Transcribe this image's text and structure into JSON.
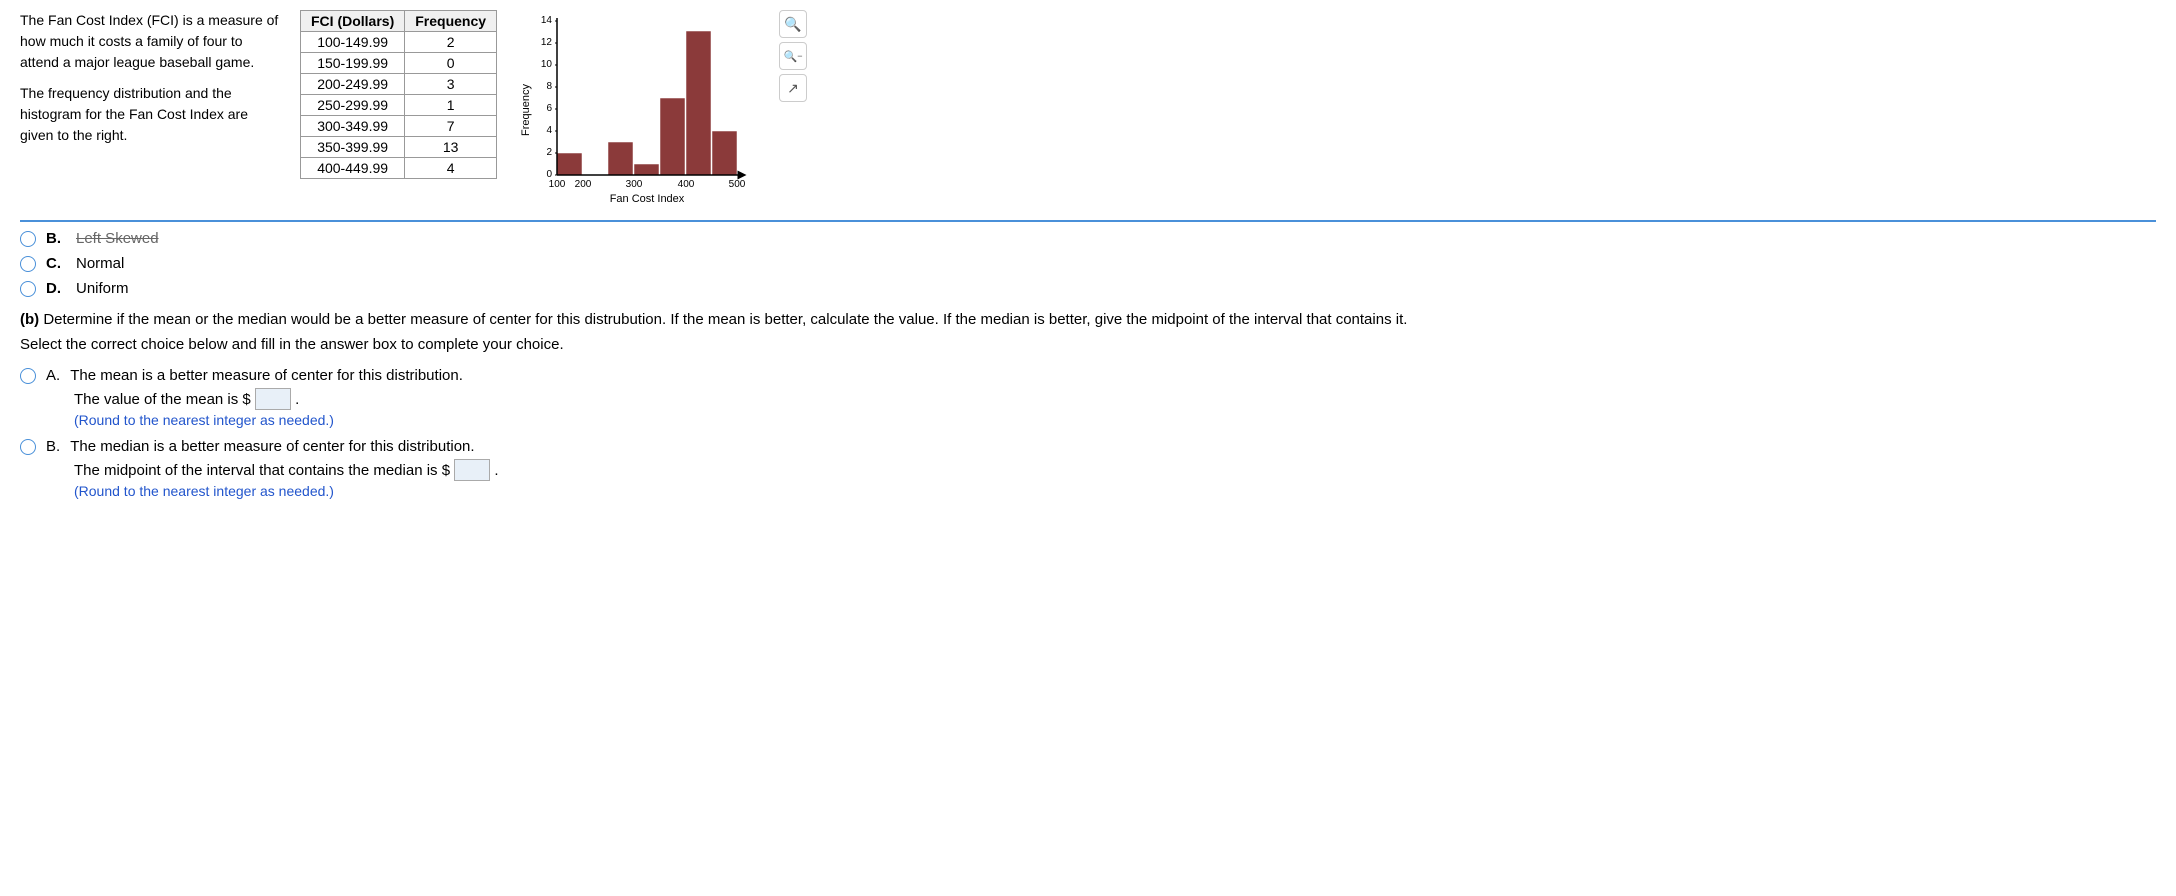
{
  "description": {
    "line1": "The Fan Cost Index (FCI) is a measure of how much it costs a family of four to attend a major league baseball game.",
    "line2": "The frequency distribution and the histogram for the Fan Cost Index are given to the right."
  },
  "table": {
    "col1_header": "FCI (Dollars)",
    "col2_header": "Frequency",
    "rows": [
      {
        "range": "100-149.99",
        "freq": "2"
      },
      {
        "range": "150-199.99",
        "freq": "0"
      },
      {
        "range": "200-249.99",
        "freq": "3"
      },
      {
        "range": "250-299.99",
        "freq": "1"
      },
      {
        "range": "300-349.99",
        "freq": "7"
      },
      {
        "range": "350-399.99",
        "freq": "13"
      },
      {
        "range": "400-449.99",
        "freq": "4"
      }
    ]
  },
  "histogram": {
    "title": "Fan Cost Index",
    "x_label": "Fan Cost Index",
    "y_label": "Frequency",
    "x_ticks": [
      "100",
      "200",
      "300",
      "400",
      "500"
    ],
    "y_max": 14,
    "bars": [
      {
        "label": "100-149",
        "height": 2
      },
      {
        "label": "150-199",
        "height": 0
      },
      {
        "label": "200-249",
        "height": 3
      },
      {
        "label": "250-299",
        "height": 1
      },
      {
        "label": "300-349",
        "height": 7
      },
      {
        "label": "350-399",
        "height": 13
      },
      {
        "label": "400-449",
        "height": 4
      }
    ]
  },
  "options_part_a": {
    "option_b_text": "Left Skewed",
    "option_c_letter": "C.",
    "option_c_text": "Normal",
    "option_d_letter": "D.",
    "option_d_text": "Uniform"
  },
  "part_b": {
    "label": "(b)",
    "question": "Determine if the mean or the median would be a better measure of center for this distrubution. If the mean is better, calculate the value. If the median is better, give the midpoint of the interval that contains it.",
    "instruction": "Select the correct choice below and fill in the answer box to complete your choice.",
    "option_a": {
      "letter": "A.",
      "main": "The mean is a better measure of center for this distribution.",
      "sub_prefix": "The value of the mean is $",
      "sub_suffix": ".",
      "hint": "(Round to the nearest integer as needed.)"
    },
    "option_b": {
      "letter": "B.",
      "main": "The median is a better measure of center for this distribution.",
      "sub_prefix": "The midpoint of the interval that contains the median is $",
      "sub_suffix": ".",
      "hint": "(Round to the nearest integer as needed.)"
    }
  },
  "controls": {
    "zoom_in": "🔍",
    "zoom_out": "🔍",
    "export": "↗"
  }
}
